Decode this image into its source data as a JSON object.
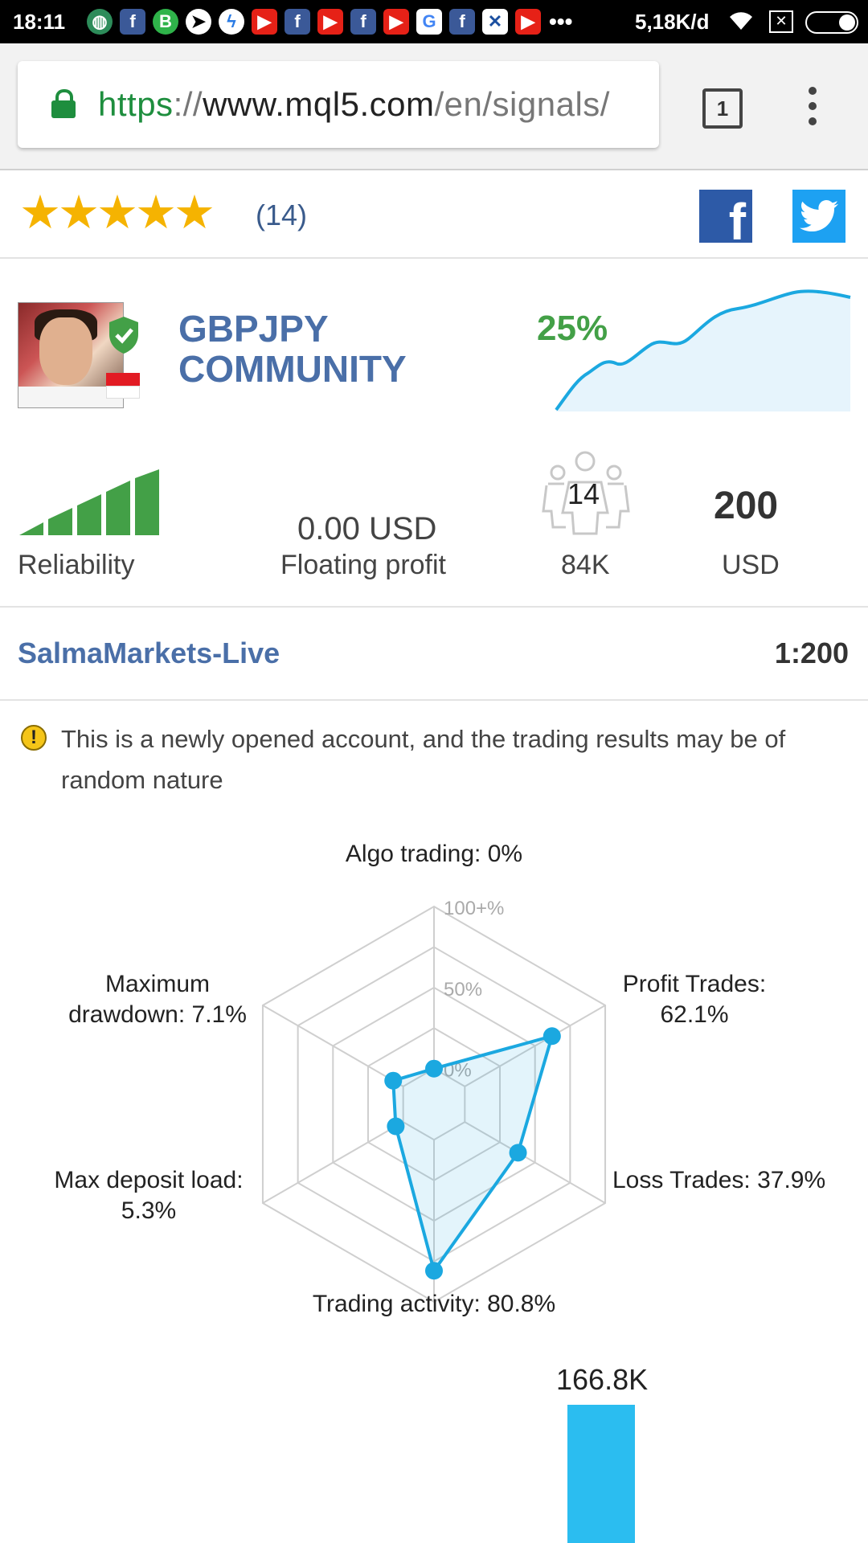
{
  "status_bar": {
    "time": "18:11",
    "notification_icons": [
      "globe-icon",
      "facebook-icon",
      "bbm-icon",
      "telegram-icon",
      "messenger-icon",
      "youtube-icon",
      "facebook-icon",
      "youtube-icon",
      "facebook-icon",
      "youtube-icon",
      "google-icon",
      "facebook-icon",
      "xl-icon",
      "youtube-icon"
    ],
    "more": "•••",
    "network_speed": "5,18K/d"
  },
  "browser": {
    "url_scheme": "https",
    "url_sep": "://",
    "url_host": "www.mql5.com",
    "url_path": "/en/signals/",
    "tab_count": "1"
  },
  "rating": {
    "stars": "★★★★★",
    "stars_value": 5,
    "count": "(14)"
  },
  "signal": {
    "name": "GBPJPY COMMUNITY",
    "growth": "25%",
    "accent_blue": "#4a6fa8",
    "growth_green": "#43a047"
  },
  "stats": {
    "reliability_label": "Reliability",
    "reliability_level": 5,
    "floating_profit_value": "0.00 USD",
    "floating_profit_label": "Floating profit",
    "subscribers": "14",
    "subscribers_funds": "84K",
    "deposit_value": "200",
    "deposit_currency": "USD"
  },
  "broker": {
    "server": "SalmaMarkets-Live",
    "leverage": "1:200"
  },
  "warning": {
    "text": "This is a newly opened account, and the trading results may be of random nature"
  },
  "chart_data": [
    {
      "type": "radar",
      "axes": [
        "Algo trading",
        "Profit Trades",
        "Loss Trades",
        "Trading activity",
        "Max deposit load",
        "Maximum drawdown"
      ],
      "values": [
        0,
        62.1,
        37.9,
        80.8,
        5.3,
        7.1
      ],
      "ring_labels": [
        "100+%",
        "50%",
        "0%"
      ],
      "labels": {
        "algo": "Algo trading: 0%",
        "profit": "Profit Trades:\n62.1%",
        "loss": "Loss Trades: 37.9%",
        "activity": "Trading activity: 80.8%",
        "deposit_load": "Max deposit load:\n5.3%",
        "drawdown": "Maximum\ndrawdown: 7.1%"
      },
      "color": "#1ba8e0"
    },
    {
      "type": "bar",
      "values": [
        166.8
      ],
      "value_labels": [
        "166.8K"
      ],
      "color": "#2bbdf0"
    }
  ]
}
